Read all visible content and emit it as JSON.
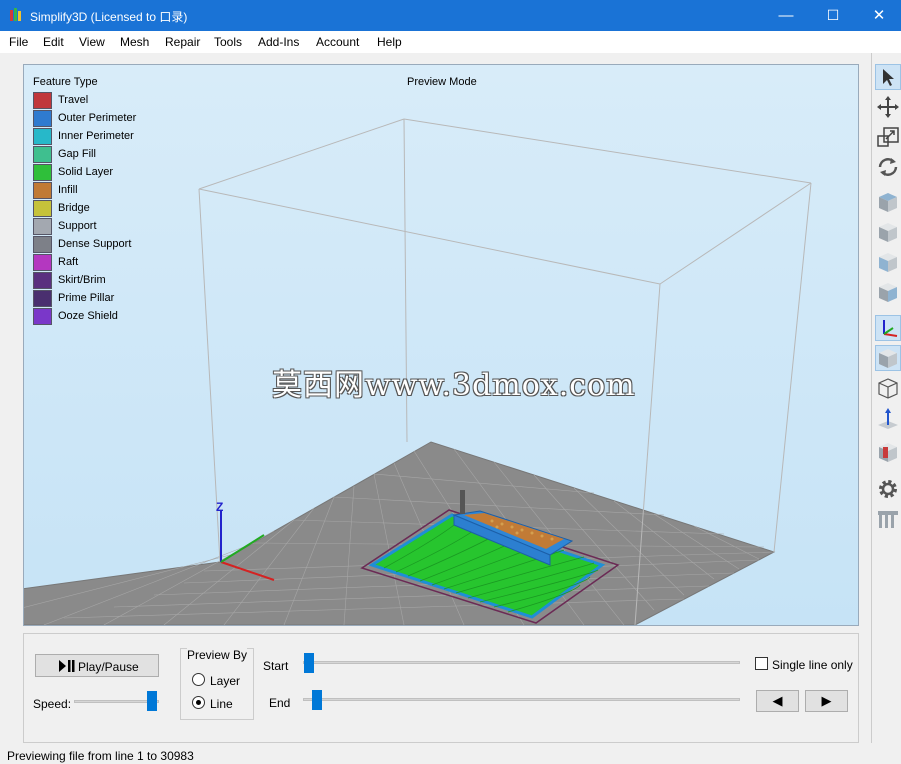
{
  "window": {
    "title": "Simplify3D (Licensed to 口录)",
    "minimize": "—",
    "maximize": "☐",
    "close": "✕"
  },
  "menu": [
    "File",
    "Edit",
    "View",
    "Mesh",
    "Repair",
    "Tools",
    "Add-Ins",
    "Account",
    "Help"
  ],
  "viewport": {
    "legend_title": "Feature Type",
    "mode_label": "Preview Mode",
    "watermark": "莫西网www.3dmox.com",
    "axis_z_label": "Z",
    "legend": [
      {
        "label": "Travel",
        "color": "#c0373c"
      },
      {
        "label": "Outer Perimeter",
        "color": "#2f7bd0"
      },
      {
        "label": "Inner Perimeter",
        "color": "#27b8c9"
      },
      {
        "label": "Gap Fill",
        "color": "#3fbf8f"
      },
      {
        "label": "Solid Layer",
        "color": "#2fbf3a"
      },
      {
        "label": "Infill",
        "color": "#c07a35"
      },
      {
        "label": "Bridge",
        "color": "#c6c23a"
      },
      {
        "label": "Support",
        "color": "#a3a8b0"
      },
      {
        "label": "Dense Support",
        "color": "#7d8088"
      },
      {
        "label": "Raft",
        "color": "#b437c0"
      },
      {
        "label": "Skirt/Brim",
        "color": "#5a2f7f"
      },
      {
        "label": "Prime Pillar",
        "color": "#4a2f6f"
      },
      {
        "label": "Ooze Shield",
        "color": "#7a37c9"
      }
    ]
  },
  "toolbar": {
    "icons": [
      "select-icon",
      "move-icon",
      "scale-icon",
      "rotate-icon",
      "view-top-icon",
      "view-front-icon",
      "view-side-icon",
      "view-iso-icon",
      "axes-icon",
      "solid-view-icon",
      "wireframe-icon",
      "normals-icon",
      "section-icon",
      "settings-gear-icon",
      "support-icon"
    ]
  },
  "controls": {
    "play_pause": "Play/Pause",
    "speed_label": "Speed:",
    "preview_by_title": "Preview By",
    "preview_by_options": [
      "Layer",
      "Line"
    ],
    "preview_by_selected": "Line",
    "start_label": "Start",
    "end_label": "End",
    "single_line_label": "Single line only",
    "single_line_checked": false,
    "prev_arrow": "◀",
    "next_arrow": "▶"
  },
  "status": {
    "text": "Previewing file from line 1 to 30983"
  }
}
